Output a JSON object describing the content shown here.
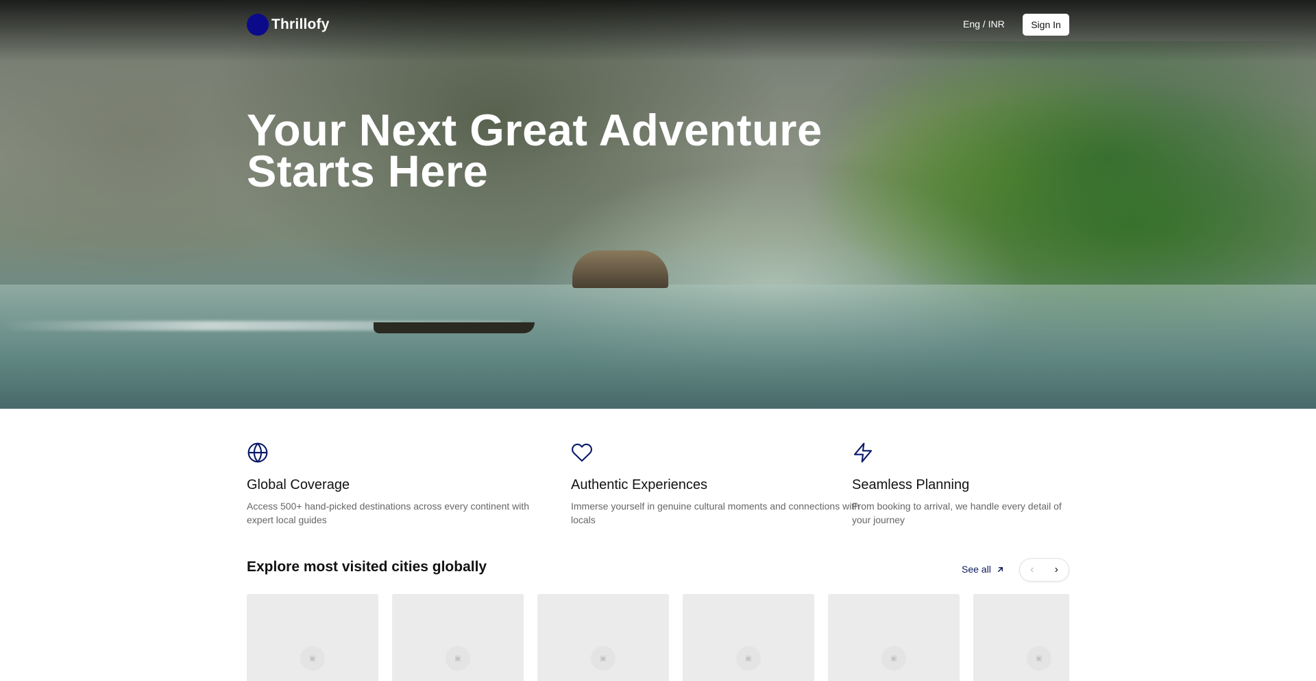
{
  "brand": {
    "name": "Thrillofy",
    "logo_color": "#0a0a8a"
  },
  "nav": {
    "locale_label": "Eng / INR",
    "signin_label": "Sign In"
  },
  "hero": {
    "title_line1": "Your Next Great Adventure",
    "title_line2": "Starts Here"
  },
  "features": [
    {
      "icon": "globe-icon",
      "title": "Global Coverage",
      "desc": "Access 500+ hand-picked destinations across every continent with expert local guides"
    },
    {
      "icon": "heart-icon",
      "title": "Authentic Experiences",
      "desc": "Immerse yourself in genuine cultural moments and connections with locals"
    },
    {
      "icon": "lightning-icon",
      "title": "Seamless Planning",
      "desc": "From booking to arrival, we handle every detail of your journey"
    }
  ],
  "explore": {
    "title": "Explore most visited cities globally",
    "see_all_label": "See all",
    "prev_icon": "chevron-left-icon",
    "next_icon": "chevron-right-icon",
    "card_count_visible": 6
  },
  "colors": {
    "accent": "#0a1a5a",
    "icon": "#0a1a6a"
  }
}
